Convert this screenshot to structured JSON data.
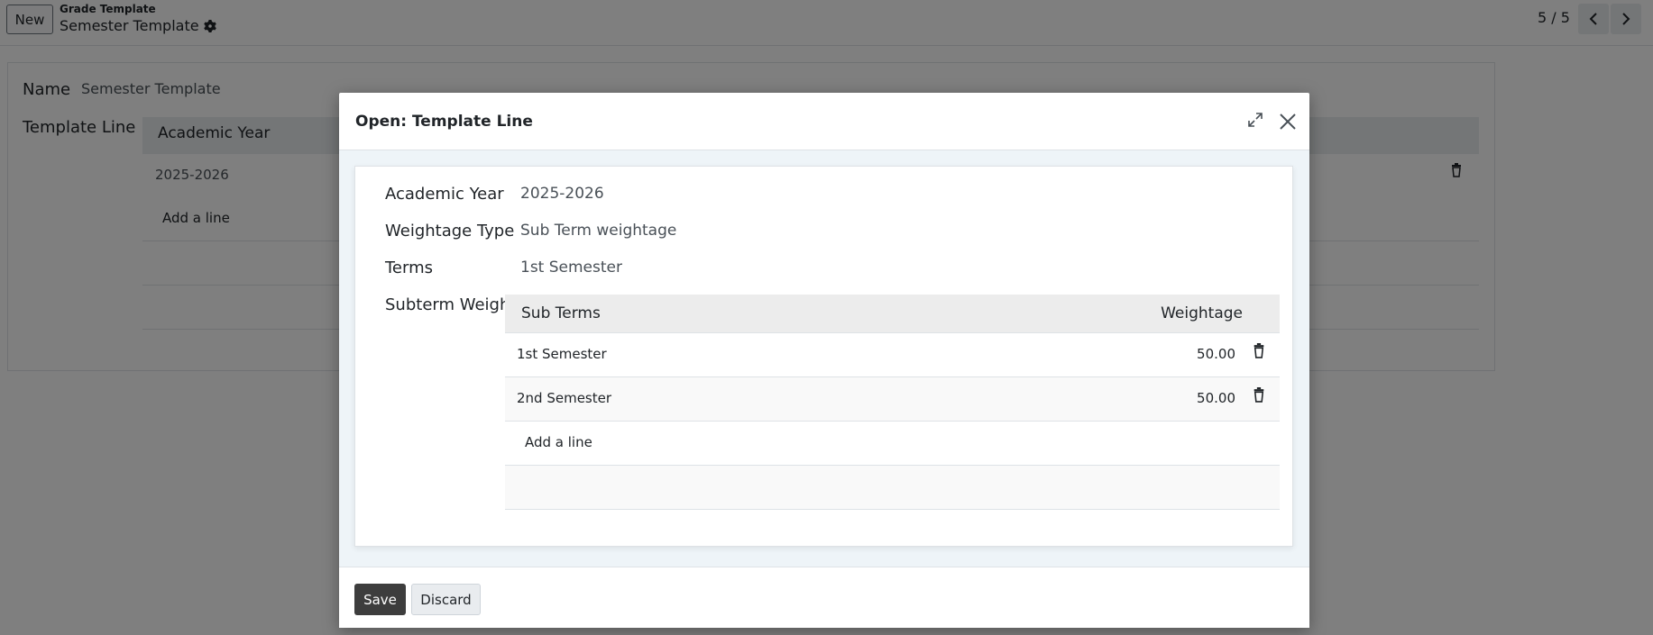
{
  "control_panel": {
    "new_label": "New",
    "breadcrumb_parent": "Grade Template",
    "breadcrumb_current": "Semester Template",
    "pager": "5 / 5"
  },
  "form": {
    "name_label": "Name",
    "name_value": "Semester Template",
    "template_line_label": "Template Line",
    "table_header_academic_year": "Academic Year",
    "rows": [
      {
        "academic_year": "2025-2026"
      }
    ],
    "add_line": "Add a line"
  },
  "dialog": {
    "title": "Open: Template Line",
    "fields": {
      "academic_year_label": "Academic Year",
      "academic_year_value": "2025-2026",
      "weightage_type_label": "Weightage Type",
      "weightage_type_value": "Sub Term weightage",
      "terms_label": "Terms",
      "terms_value": "1st Semester",
      "subterm_weight_label": "Subterm Weight"
    },
    "subterm_table": {
      "headers": {
        "sub_terms": "Sub Terms",
        "weightage": "Weightage"
      },
      "rows": [
        {
          "sub_term": "1st Semester",
          "weightage": "50.00"
        },
        {
          "sub_term": "2nd Semester",
          "weightage": "50.00"
        }
      ],
      "add_line": "Add a line"
    },
    "footer": {
      "save_label": "Save",
      "discard_label": "Discard"
    }
  },
  "icons": {
    "gear": "gear-icon",
    "prev": "chevron-left-icon",
    "next": "chevron-right-icon",
    "trash": "trash-icon",
    "expand": "expand-icon",
    "close": "close-icon"
  },
  "colors": {
    "overlay": "#000000",
    "save_button": "#3d3d3d",
    "table_header": "#ececec",
    "modal_body_bg": "#eef4f8"
  }
}
